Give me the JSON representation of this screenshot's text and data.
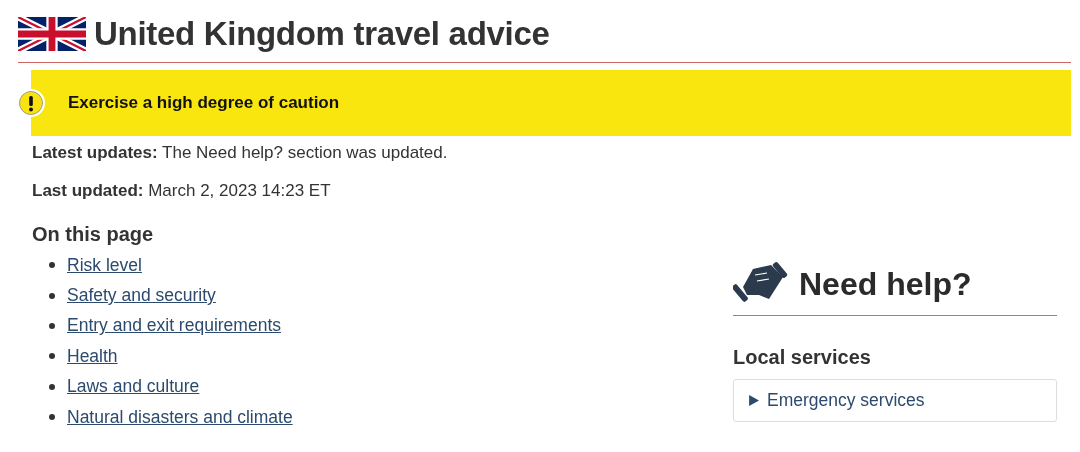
{
  "title": "United Kingdom travel advice",
  "banner": {
    "text": "Exercise a high degree of caution"
  },
  "updates": [
    {
      "label": "Latest updates:",
      "value": "The Need help? section was updated."
    },
    {
      "label": "Last updated:",
      "value": "March 2, 2023 14:23 ET"
    }
  ],
  "on_this_page": {
    "heading": "On this page",
    "links": [
      "Risk level",
      "Safety and security",
      "Entry and exit requirements",
      "Health",
      "Laws and culture",
      "Natural disasters and climate"
    ]
  },
  "need_help": {
    "heading": "Need help?",
    "subheading": "Local services",
    "expanders": [
      {
        "label": "Emergency services",
        "expanded": false
      }
    ]
  }
}
